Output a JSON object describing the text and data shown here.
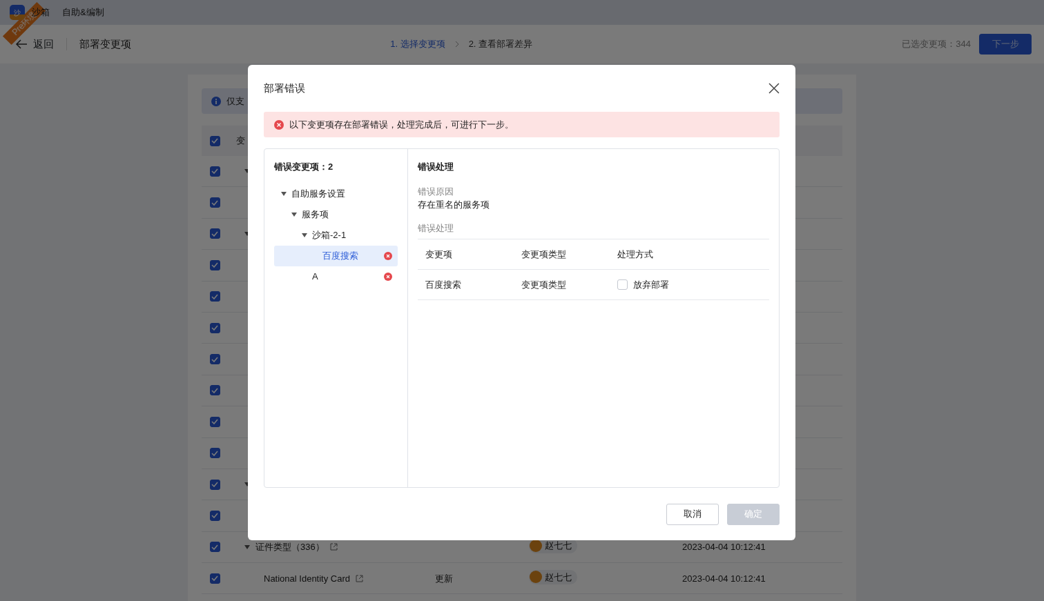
{
  "app_header": {
    "logo_glyph": "沙",
    "app_name": "沙箱",
    "env_ribbon": "Pre环境",
    "title": "自助&编制"
  },
  "toolbar": {
    "back": "返回",
    "page_title": "部署变更项",
    "steps": [
      {
        "label": "1. 选择变更项",
        "selected": true
      },
      {
        "label": "2. 查看部署差异",
        "selected": false
      }
    ],
    "selected_count": "已选变更项：344",
    "next_button": "下一步"
  },
  "background": {
    "notice": "仅支",
    "header": {
      "checked": true,
      "label": "变"
    },
    "rows": [
      {
        "checked": true,
        "expandable": true
      },
      {
        "checked": true,
        "expandable": false
      },
      {
        "checked": true,
        "expandable": true
      },
      {
        "checked": true,
        "expandable": false
      },
      {
        "checked": true,
        "expandable": false
      },
      {
        "checked": true,
        "expandable": false
      },
      {
        "checked": true,
        "expandable": false
      },
      {
        "checked": true,
        "expandable": false
      },
      {
        "checked": true,
        "expandable": false
      },
      {
        "checked": true,
        "expandable": false
      },
      {
        "checked": true,
        "expandable": true
      },
      {
        "checked": true,
        "expandable": false
      },
      {
        "checked": true,
        "expandable": true,
        "name": "证件类型（336）",
        "user": "赵七七",
        "time": "2023-04-04 10:12:41"
      },
      {
        "checked": true,
        "expandable": false,
        "name": "National Identity Card",
        "type": "更新",
        "user": "赵七七",
        "time": "2023-04-04 10:12:41"
      }
    ]
  },
  "dialog": {
    "title": "部署错误",
    "alert": "以下变更项存在部署错误，处理完成后，可进行下一步。",
    "error_count": "错误变更项：2",
    "tree": [
      {
        "label": "自助服务设置",
        "expanded": true,
        "children": [
          {
            "label": "服务项",
            "expanded": true,
            "children": [
              {
                "label": "沙箱-2-1",
                "expanded": true,
                "children": [
                  {
                    "label": "百度搜索",
                    "selected": true,
                    "error": true
                  }
                ]
              },
              {
                "label": "A",
                "selected": false,
                "error": true
              }
            ]
          }
        ]
      }
    ],
    "detail": {
      "title": "错误处理",
      "reason_label": "错误原因",
      "reason": "存在重名的服务项",
      "handling_label": "错误处理",
      "columns": [
        "变更项",
        "变更项类型",
        "处理方式"
      ],
      "rows": [
        {
          "item": "百度搜索",
          "type": "变更项类型",
          "action": "放弃部署",
          "checked": false
        }
      ]
    },
    "buttons": [
      {
        "label": "取消",
        "disabled": false,
        "kind": "default"
      },
      {
        "label": "确定",
        "disabled": true,
        "kind": "primary"
      }
    ]
  }
}
